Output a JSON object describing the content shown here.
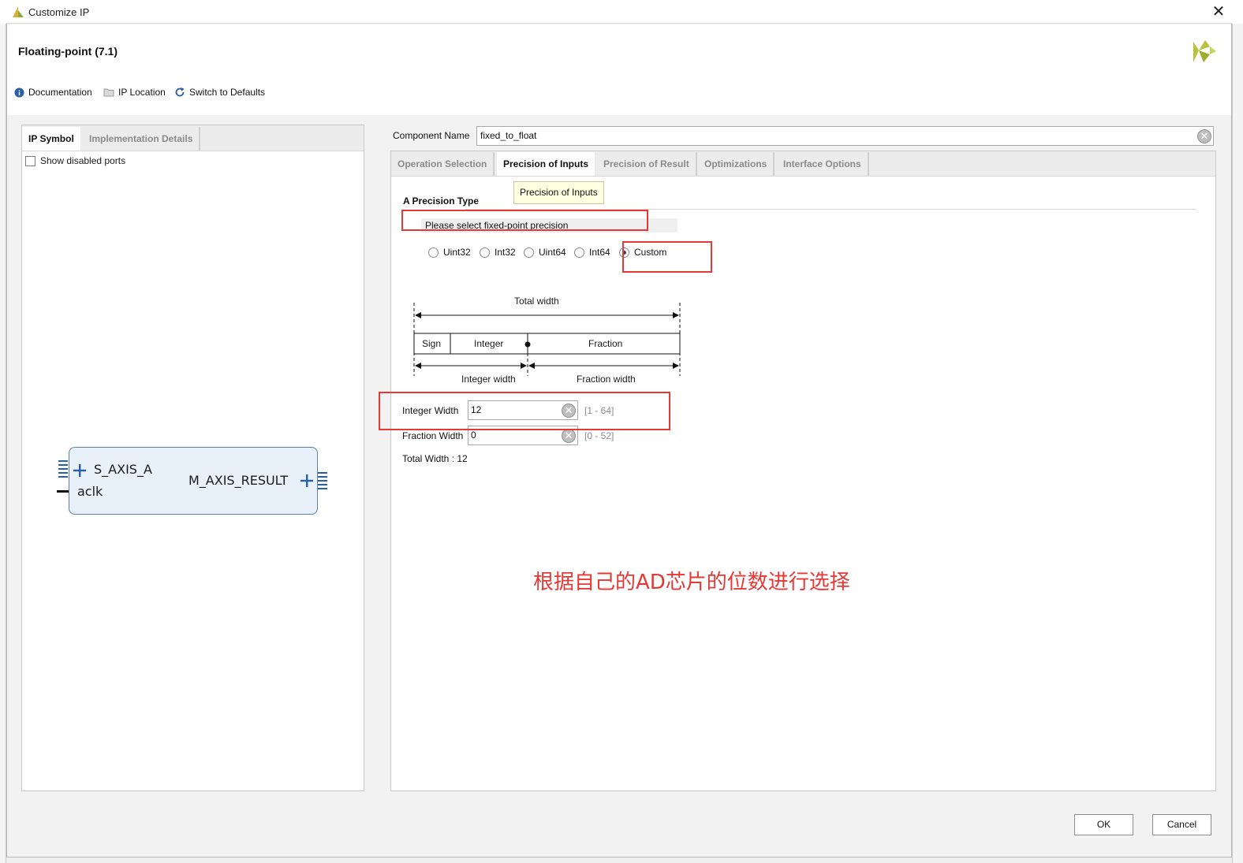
{
  "window": {
    "title": "Customize IP",
    "close_label": "✕"
  },
  "header": {
    "ip_title": "Floating-point (7.1)",
    "toolbar": {
      "documentation": "Documentation",
      "ip_location": "IP Location",
      "switch_defaults": "Switch to Defaults"
    }
  },
  "left_panel": {
    "tabs": [
      "IP Symbol",
      "Implementation Details"
    ],
    "show_disabled_ports": "Show disabled ports",
    "ports": {
      "input": "S_AXIS_A",
      "clock": "aclk",
      "output": "M_AXIS_RESULT"
    }
  },
  "component": {
    "label": "Component Name",
    "value": "fixed_to_float"
  },
  "tabs": [
    "Operation Selection",
    "Precision of Inputs",
    "Precision of Result",
    "Optimizations",
    "Interface Options"
  ],
  "tooltip": "Precision of Inputs",
  "precision": {
    "section_title": "A Precision Type",
    "hint": "Please select fixed-point precision",
    "options": [
      "Uint32",
      "Int32",
      "Uint64",
      "Int64",
      "Custom"
    ],
    "selected": "Custom"
  },
  "diagram": {
    "total_width": "Total width",
    "sign": "Sign",
    "integer": "Integer",
    "fraction": "Fraction",
    "integer_width": "Integer width",
    "fraction_width": "Fraction width"
  },
  "fields": {
    "integer_width": {
      "label": "Integer Width",
      "value": "12",
      "range": "[1 - 64]"
    },
    "fraction_width": {
      "label": "Fraction Width",
      "value": "0",
      "range": "[0 - 52]"
    },
    "total_width": "Total Width : 12"
  },
  "annotation": "根据自己的AD芯片的位数进行选择",
  "buttons": {
    "ok": "OK",
    "cancel": "Cancel"
  },
  "colors": {
    "annotation_red": "#e53935",
    "block_fill": "#e8f0fa",
    "block_border": "#5b7fb2",
    "tooltip_bg": "#ffffe1"
  }
}
